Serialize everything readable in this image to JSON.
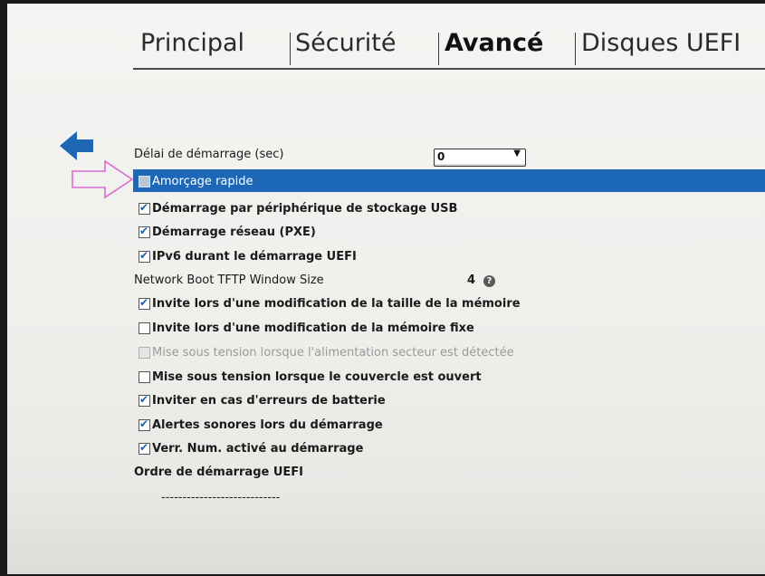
{
  "tabs": [
    "Principal",
    "Sécurité",
    "Avancé",
    "Disques UEFI"
  ],
  "active_tab": "Avancé",
  "boot_delay": {
    "label": "Délai de démarrage (sec)",
    "value": "0"
  },
  "fast_boot": {
    "label": "Amorçage rapide",
    "checked": false,
    "selected": true
  },
  "options": [
    {
      "label": "Démarrage par périphérique de stockage USB",
      "checked": true
    },
    {
      "label": "Démarrage réseau (PXE)",
      "checked": true
    },
    {
      "label": "IPv6 durant le démarrage UEFI",
      "checked": true
    }
  ],
  "tftp": {
    "label": "Network Boot TFTP Window Size",
    "value": "4",
    "help_icon": "question-mark-icon"
  },
  "options2": [
    {
      "label": "Invite lors d'une modification de la taille de la mémoire",
      "checked": true,
      "disabled": false
    },
    {
      "label": "Invite lors d'une modification de la mémoire fixe",
      "checked": false,
      "disabled": false
    },
    {
      "label": "Mise sous tension lorsque l'alimentation secteur est détectée",
      "checked": false,
      "disabled": true
    },
    {
      "label": "Mise sous tension lorsque le couvercle est ouvert",
      "checked": false,
      "disabled": false
    },
    {
      "label": "Inviter en cas d'erreurs de batterie",
      "checked": true,
      "disabled": false
    },
    {
      "label": "Alertes sonores lors du démarrage",
      "checked": true,
      "disabled": false
    },
    {
      "label": "Verr. Num. activé au démarrage",
      "checked": true,
      "disabled": false
    }
  ],
  "uefi_order": {
    "label": "Ordre de démarrage UEFI",
    "placeholder": "----------------------------"
  },
  "colors": {
    "highlight": "#1c67b6",
    "annotation_arrow": "#d96bd0",
    "back_arrow": "#1f67b4",
    "check": "#1f5fa8"
  }
}
